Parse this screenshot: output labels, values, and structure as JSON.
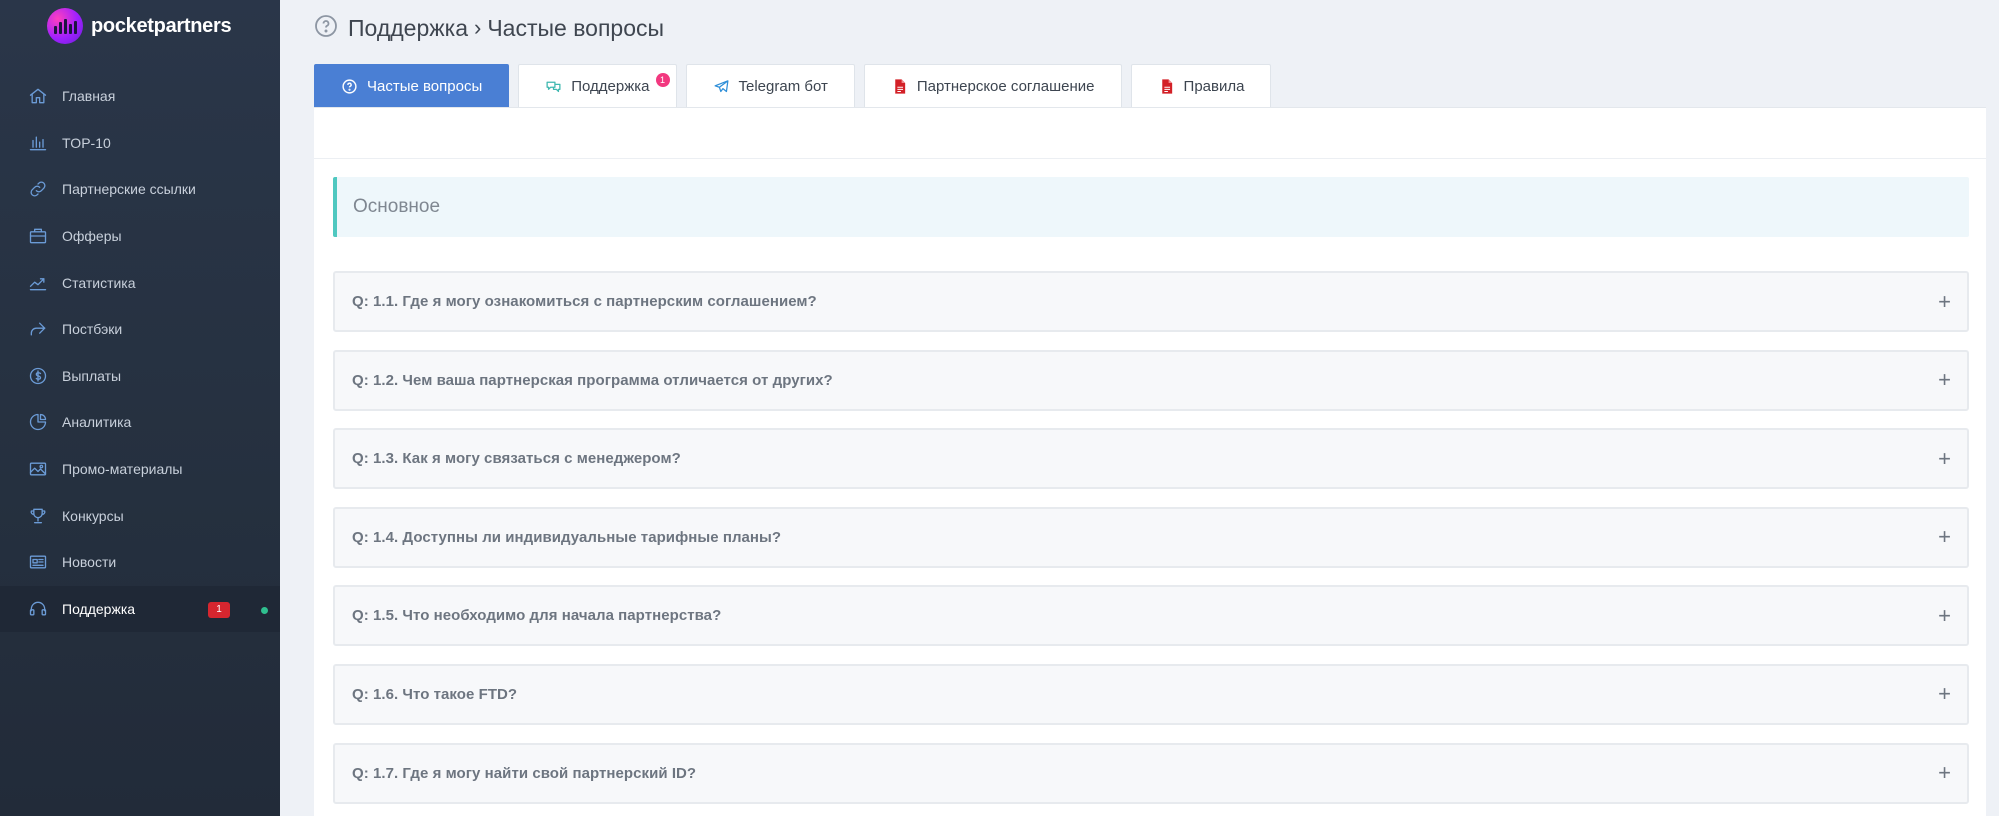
{
  "brand": {
    "name": "pocketpartners"
  },
  "sidebar": {
    "items": [
      {
        "label": "Главная",
        "icon": "home-icon"
      },
      {
        "label": "TOP-10",
        "icon": "bar-chart-icon"
      },
      {
        "label": "Партнерские ссылки",
        "icon": "link-icon"
      },
      {
        "label": "Офферы",
        "icon": "briefcase-icon"
      },
      {
        "label": "Статистика",
        "icon": "line-chart-icon"
      },
      {
        "label": "Постбэки",
        "icon": "share-arrow-icon"
      },
      {
        "label": "Выплаты",
        "icon": "dollar-coin-icon"
      },
      {
        "label": "Аналитика",
        "icon": "pie-chart-icon"
      },
      {
        "label": "Промо-материалы",
        "icon": "image-icon"
      },
      {
        "label": "Конкурсы",
        "icon": "trophy-icon"
      },
      {
        "label": "Новости",
        "icon": "newspaper-icon"
      },
      {
        "label": "Поддержка",
        "icon": "headset-icon",
        "badge": "1",
        "active": true
      }
    ]
  },
  "header": {
    "breadcrumb_parent": "Поддержка",
    "breadcrumb_separator": "›",
    "breadcrumb_current": "Частые вопросы"
  },
  "tabs": [
    {
      "label": "Частые вопросы",
      "icon": "question-circle-icon",
      "active": true
    },
    {
      "label": "Поддержка",
      "icon": "chat-bubbles-icon",
      "badge": "1"
    },
    {
      "label": "Telegram бот",
      "icon": "telegram-icon"
    },
    {
      "label": "Партнерское соглашение",
      "icon": "pdf-document-icon"
    },
    {
      "label": "Правила",
      "icon": "pdf-document-icon"
    }
  ],
  "section": {
    "title": "Основное"
  },
  "faq": [
    {
      "question": "Q: 1.1. Где я могу ознакомиться с партнерским соглашением?",
      "toggle": "+"
    },
    {
      "question": "Q: 1.2. Чем ваша партнерская программа отличается от других?",
      "toggle": "+"
    },
    {
      "question": "Q: 1.3. Как я могу связаться с менеджером?",
      "toggle": "+"
    },
    {
      "question": "Q: 1.4. Доступны ли индивидуальные тарифные планы?",
      "toggle": "+"
    },
    {
      "question": "Q: 1.5. Что необходимо для начала партнерства?",
      "toggle": "+"
    },
    {
      "question": "Q: 1.6. Что такое FTD?",
      "toggle": "+"
    },
    {
      "question": "Q: 1.7. Где я могу найти свой партнерский ID?",
      "toggle": "+"
    }
  ],
  "colors": {
    "sidebar_bg": "#25303f",
    "accent_blue": "#4a7fd4",
    "section_accent": "#4fc8c0",
    "badge_red": "#d6262f",
    "badge_pink": "#f2387f",
    "online_dot": "#2fbf8f"
  }
}
